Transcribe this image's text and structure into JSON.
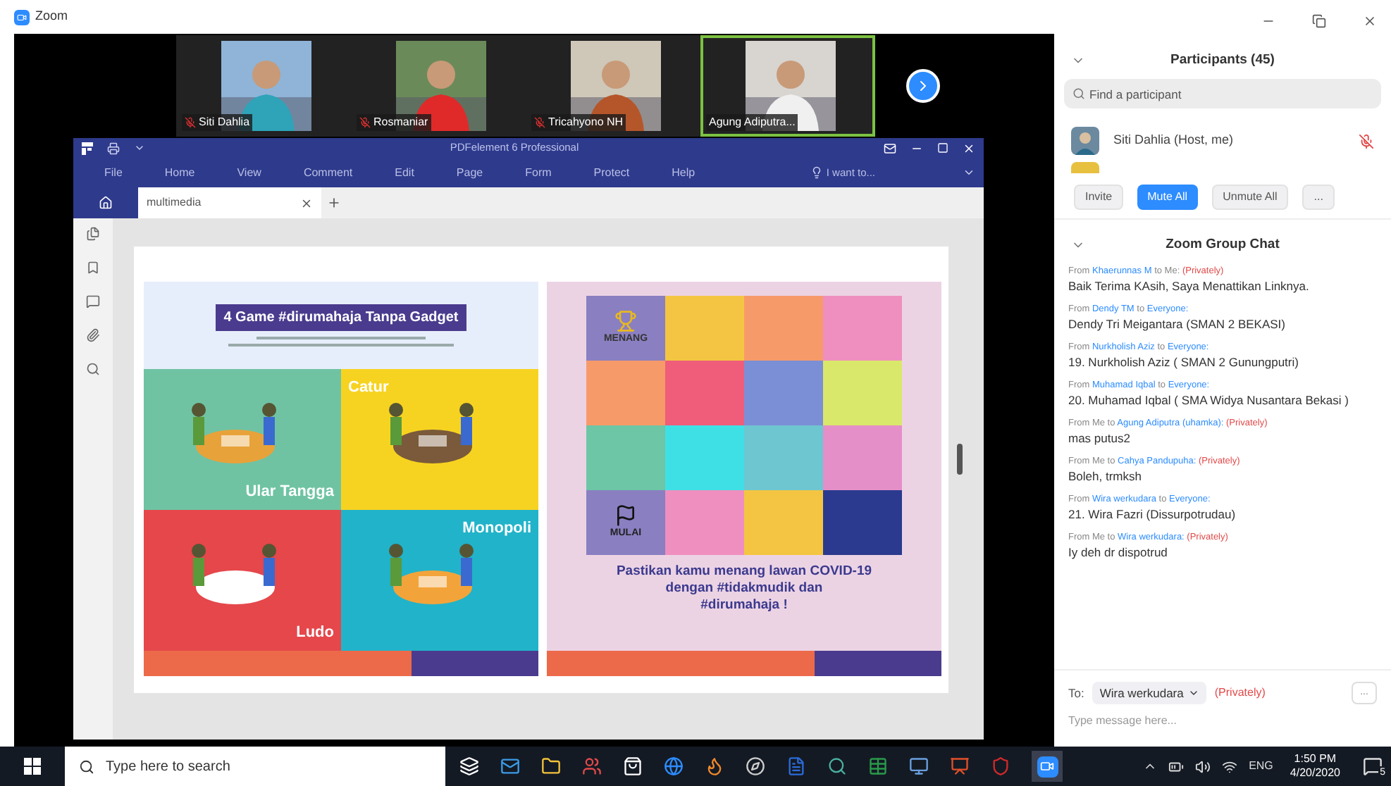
{
  "app_title": "Zoom",
  "videos": [
    {
      "name": "Siti Dahlia",
      "muted": true,
      "active": false
    },
    {
      "name": "Rosmaniar",
      "muted": true,
      "active": false
    },
    {
      "name": "Tricahyono NH",
      "muted": true,
      "active": false
    },
    {
      "name": "Agung Adiputra...",
      "muted": false,
      "active": true
    }
  ],
  "pdf": {
    "title": "PDFelement 6 Professional",
    "menu": [
      "File",
      "Home",
      "View",
      "Comment",
      "Edit",
      "Page",
      "Form",
      "Protect",
      "Help"
    ],
    "help_search": "I want to...",
    "tabs": [
      {
        "label": "multimedia",
        "selected": true
      }
    ],
    "games_poster": {
      "title": "4 Game #dirumahaja Tanpa Gadget",
      "games": [
        "Ular Tangga",
        "Catur",
        "Ludo",
        "Monopoli"
      ]
    },
    "board_poster": {
      "finish_label": "MENANG",
      "start_label": "MULAI",
      "caption": [
        "Pastikan kamu menang lawan COVID-19",
        "dengan #tidakmudik dan",
        "#dirumahaja !"
      ]
    }
  },
  "participants": {
    "title": "Participants (45)",
    "search_placeholder": "Find a participant",
    "list": [
      {
        "name": "Siti Dahlia (Host, me)",
        "muted": true
      }
    ],
    "buttons": [
      {
        "label": "Invite",
        "kind": "default"
      },
      {
        "label": "Mute All",
        "kind": "primary"
      },
      {
        "label": "Unmute All",
        "kind": "default"
      },
      {
        "label": "...",
        "kind": "default"
      }
    ]
  },
  "chat": {
    "title": "Zoom Group Chat",
    "messages": [
      {
        "header": [
          {
            "text": "From",
            "kind": "plain"
          },
          {
            "text": "Khaerunnas M",
            "kind": "name"
          },
          {
            "text": "to Me:",
            "kind": "plain"
          },
          {
            "text": "(Privately)",
            "kind": "private"
          }
        ],
        "text": "Baik Terima KAsih, Saya Menattikan Linknya."
      },
      {
        "header": [
          {
            "text": "From",
            "kind": "plain"
          },
          {
            "text": "Dendy TM",
            "kind": "name"
          },
          {
            "text": "to",
            "kind": "plain"
          },
          {
            "text": "Everyone:",
            "kind": "name"
          }
        ],
        "text": "Dendy Tri Meigantara (SMAN 2 BEKASI)"
      },
      {
        "header": [
          {
            "text": "From",
            "kind": "plain"
          },
          {
            "text": "Nurkholish Aziz",
            "kind": "name"
          },
          {
            "text": "to",
            "kind": "plain"
          },
          {
            "text": "Everyone:",
            "kind": "name"
          }
        ],
        "text": "19. Nurkholish Aziz ( SMAN 2 Gunungputri)"
      },
      {
        "header": [
          {
            "text": "From",
            "kind": "plain"
          },
          {
            "text": "Muhamad Iqbal",
            "kind": "name"
          },
          {
            "text": "to",
            "kind": "plain"
          },
          {
            "text": "Everyone:",
            "kind": "name"
          }
        ],
        "text": "20. Muhamad Iqbal ( SMA Widya Nusantara Bekasi )"
      },
      {
        "header": [
          {
            "text": "From Me to",
            "kind": "plain"
          },
          {
            "text": "Agung Adiputra (uhamka):",
            "kind": "name"
          },
          {
            "text": "(Privately)",
            "kind": "private"
          }
        ],
        "text": "mas putus2"
      },
      {
        "header": [
          {
            "text": "From Me to",
            "kind": "plain"
          },
          {
            "text": "Cahya Pandupuha:",
            "kind": "name"
          },
          {
            "text": "(Privately)",
            "kind": "private"
          }
        ],
        "text": "Boleh, trmksh"
      },
      {
        "header": [
          {
            "text": "From",
            "kind": "plain"
          },
          {
            "text": "Wira werkudara",
            "kind": "name"
          },
          {
            "text": "to",
            "kind": "plain"
          },
          {
            "text": "Everyone:",
            "kind": "name"
          }
        ],
        "text": "21. Wira Fazri (Dissurpotrudau)"
      },
      {
        "header": [
          {
            "text": "From Me to",
            "kind": "plain"
          },
          {
            "text": "Wira werkudara:",
            "kind": "name"
          },
          {
            "text": "(Privately)",
            "kind": "private"
          }
        ],
        "text": "Iy deh dr dispotrud"
      }
    ],
    "to_label": "To:",
    "recipient": "Wira werkudara",
    "privacy": "(Privately)",
    "more": "...",
    "placeholder": "Type message here..."
  },
  "taskbar": {
    "search_placeholder": "Type here to search",
    "language": "ENG",
    "time": "1:50 PM",
    "date": "4/20/2020",
    "notifications": "5"
  }
}
